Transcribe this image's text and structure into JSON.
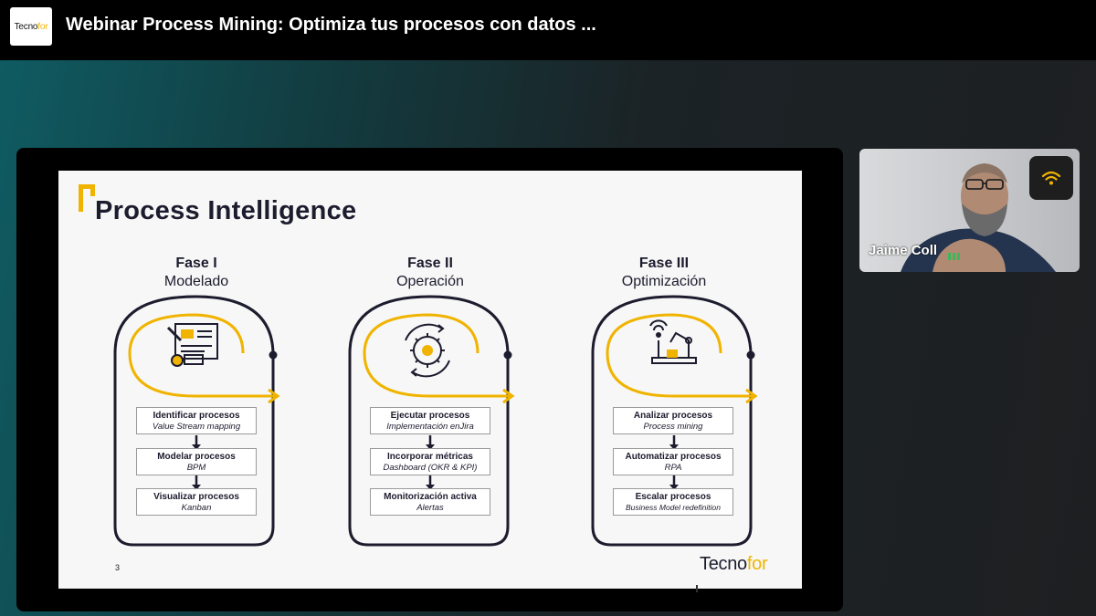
{
  "header": {
    "logo_prefix": "Tecno",
    "logo_suffix": "for",
    "title": "Webinar Process Mining: Optimiza tus procesos con datos ..."
  },
  "slide": {
    "title": "Process Intelligence",
    "page_number": "3",
    "brand_prefix": "Tecno",
    "brand_suffix": "for",
    "accent_color": "#f0b400",
    "ink_color": "#1c1c2e",
    "phases": [
      {
        "name": "Fase I",
        "subtitle": "Modelado",
        "icon": "blueprint-icon",
        "steps": [
          {
            "title": "Identificar procesos",
            "subtitle": "Value Stream mapping"
          },
          {
            "title": "Modelar procesos",
            "subtitle": "BPM"
          },
          {
            "title": "Visualizar procesos",
            "subtitle": "Kanban"
          }
        ]
      },
      {
        "name": "Fase II",
        "subtitle": "Operación",
        "icon": "gear-cycle-icon",
        "steps": [
          {
            "title": "Ejecutar procesos",
            "subtitle": "Implementación enJira"
          },
          {
            "title": "Incorporar métricas",
            "subtitle": "Dashboard (OKR & KPI)"
          },
          {
            "title": "Monitorización activa",
            "subtitle": "Alertas"
          }
        ]
      },
      {
        "name": "Fase III",
        "subtitle": "Optimización",
        "icon": "robot-arm-icon",
        "steps": [
          {
            "title": "Analizar procesos",
            "subtitle": "Process mining"
          },
          {
            "title": "Automatizar procesos",
            "subtitle": "RPA"
          },
          {
            "title": "Escalar procesos",
            "subtitle": "Business Model redefinition"
          }
        ]
      }
    ]
  },
  "participant": {
    "name": "Jaime Coll",
    "connection_icon": "wifi-icon",
    "talking_color": "#3cb85a"
  }
}
